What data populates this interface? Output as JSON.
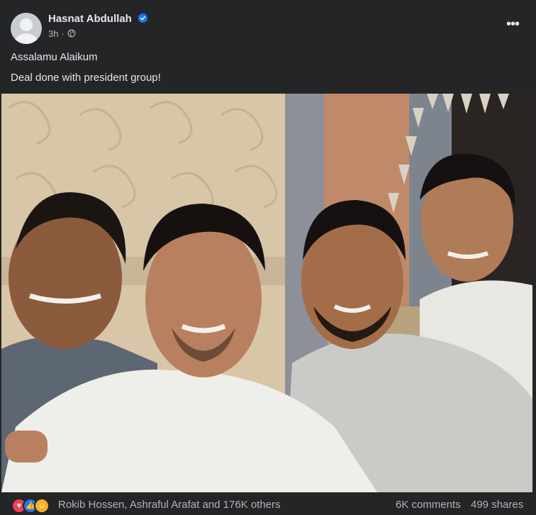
{
  "post": {
    "author": "Hasnat Abdullah",
    "time": "3h",
    "separator": "·",
    "audience_icon": "globe-icon",
    "verified_icon": "verified-badge-icon",
    "more_icon": "more-options-icon",
    "text_line1": "Assalamu Alaikum",
    "text_line2": "Deal done with president group!",
    "photo": "group-selfie-photo"
  },
  "footer": {
    "reactions": [
      "love-reaction-icon",
      "like-reaction-icon",
      "care-reaction-icon"
    ],
    "reactors_text": "Rokib Hossen, Ashraful Arafat and 176K others",
    "comments": "6K comments",
    "shares": "499 shares"
  },
  "colors": {
    "background": "#242526",
    "text_primary": "#e4e6eb",
    "text_secondary": "#b0b3b8",
    "verified": "#1877f2",
    "love": "#f33e58",
    "like": "#1877f2",
    "care": "#f7b125"
  }
}
